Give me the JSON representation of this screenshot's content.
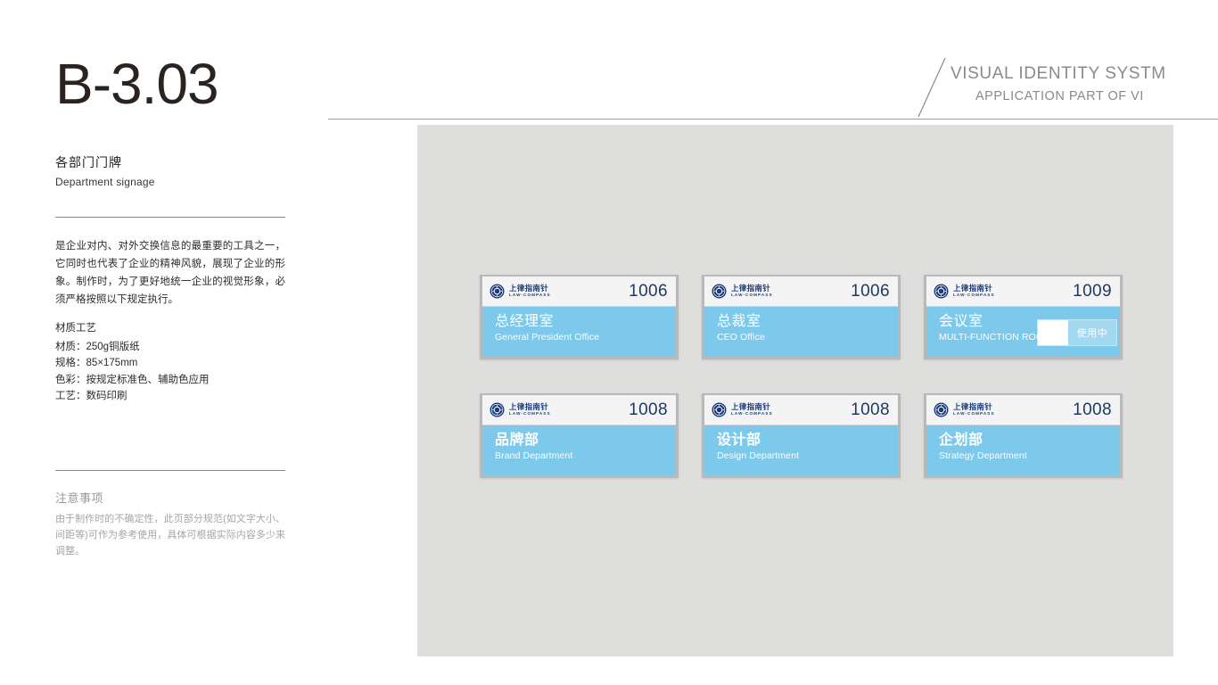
{
  "left": {
    "page_code": "B-3.03",
    "section_title_cn": "各部门门牌",
    "section_title_en": "Department signage",
    "paragraph": "是企业对内、对外交换信息的最重要的工具之一，它同时也代表了企业的精神风貌，展现了企业的形象。制作时，为了更好地统一企业的视觉形象，必须严格按照以下规定执行。",
    "spec": {
      "heading": "材质工艺",
      "rows": [
        {
          "label": "材质：",
          "value": "250g铜版纸"
        },
        {
          "label": "规格：",
          "value": " 85×175mm"
        },
        {
          "label": "色彩：",
          "value": "按规定标准色、辅助色应用"
        },
        {
          "label": "工艺：",
          "value": "数码印刷"
        }
      ]
    },
    "notice": {
      "title": "注意事项",
      "body": "由于制作时的不确定性，此页部分规范(如文字大小、间距等)可作为参考使用，具体可根据实际内容多少来调整。"
    }
  },
  "header": {
    "line1": "VISUAL IDENTITY SYSTM",
    "line2": "APPLICATION PART OF VI"
  },
  "brand": {
    "logo_cn": "上律指南针",
    "logo_en": "LAW-COMPASS"
  },
  "colors": {
    "sign_blue": "#7cc9ec",
    "sign_number": "#1f3864",
    "logo_blue": "#1b3a7a",
    "stage_gray": "#dededd",
    "badge_blue": "#a3d9f0"
  },
  "signs": [
    [
      {
        "room": "1006",
        "name_cn": "总经理室",
        "name_en": "General President Office",
        "bold_cn": false,
        "occupancy": null
      },
      {
        "room": "1006",
        "name_cn": "总裁室",
        "name_en": "CEO Office",
        "bold_cn": false,
        "occupancy": null
      },
      {
        "room": "1009",
        "name_cn": "会议室",
        "name_en": "MULTI-FUNCTION ROOM",
        "bold_cn": false,
        "occupancy": "使用中"
      }
    ],
    [
      {
        "room": "1008",
        "name_cn": "品牌部",
        "name_en": "Brand Department",
        "bold_cn": true,
        "occupancy": null
      },
      {
        "room": "1008",
        "name_cn": "设计部",
        "name_en": "Design Department",
        "bold_cn": true,
        "occupancy": null
      },
      {
        "room": "1008",
        "name_cn": "企划部",
        "name_en": "Strategy Department",
        "bold_cn": true,
        "occupancy": null
      }
    ]
  ]
}
